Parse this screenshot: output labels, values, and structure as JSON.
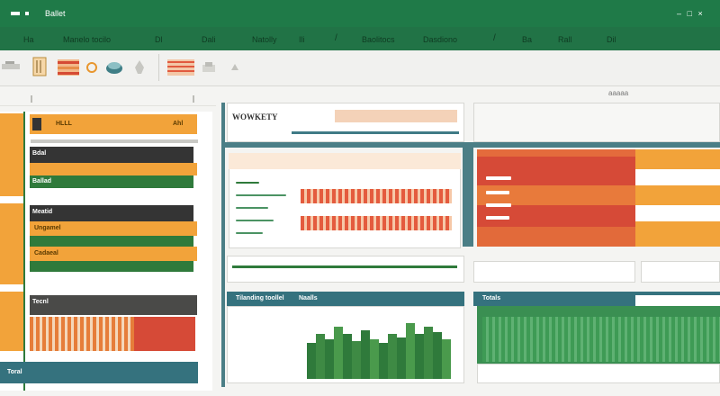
{
  "window": {
    "title": "Ballet",
    "controls": "‒ □ ×"
  },
  "ribbon_tabs": [
    {
      "label": "Ha"
    },
    {
      "label": "Manelo tocilo"
    },
    {
      "label": "Dl"
    },
    {
      "label": "Dali"
    },
    {
      "label": "Natolly"
    },
    {
      "label": "Ili"
    },
    {
      "label": "Baolitocs"
    },
    {
      "label": "Dasdiono"
    },
    {
      "label": "Ba"
    },
    {
      "label": "Rall"
    },
    {
      "label": "Dil"
    }
  ],
  "ribbon_icons": [
    "paste-icon",
    "format-icon",
    "table-icon",
    "circle-icon",
    "chart-icon",
    "shape-icon",
    "bars-icon",
    "shading-icon",
    "fill-icon"
  ],
  "top_right_toolbar": {
    "label": "aaaaa"
  },
  "left_pane": {
    "header_label": "HLLL",
    "header_right": "Ahl",
    "row_labels": [
      "Bdal",
      "Ballad",
      "Meatid",
      "Ungamel",
      "Cadaeal",
      "Tecnl"
    ]
  },
  "center_top": {
    "title": "WOWKETY"
  },
  "colors": {
    "brand": "#217346",
    "accent_orange": "#f2a33a",
    "accent_red": "#d64a37",
    "accent_green": "#2f7a3b",
    "accent_teal": "#4b7e86"
  },
  "section_labels": {
    "left_bottom": "Toral",
    "center_bottom_left": "Tilanding toollel",
    "center_bottom_right": "Naalls",
    "right_bottom": "Totals"
  }
}
